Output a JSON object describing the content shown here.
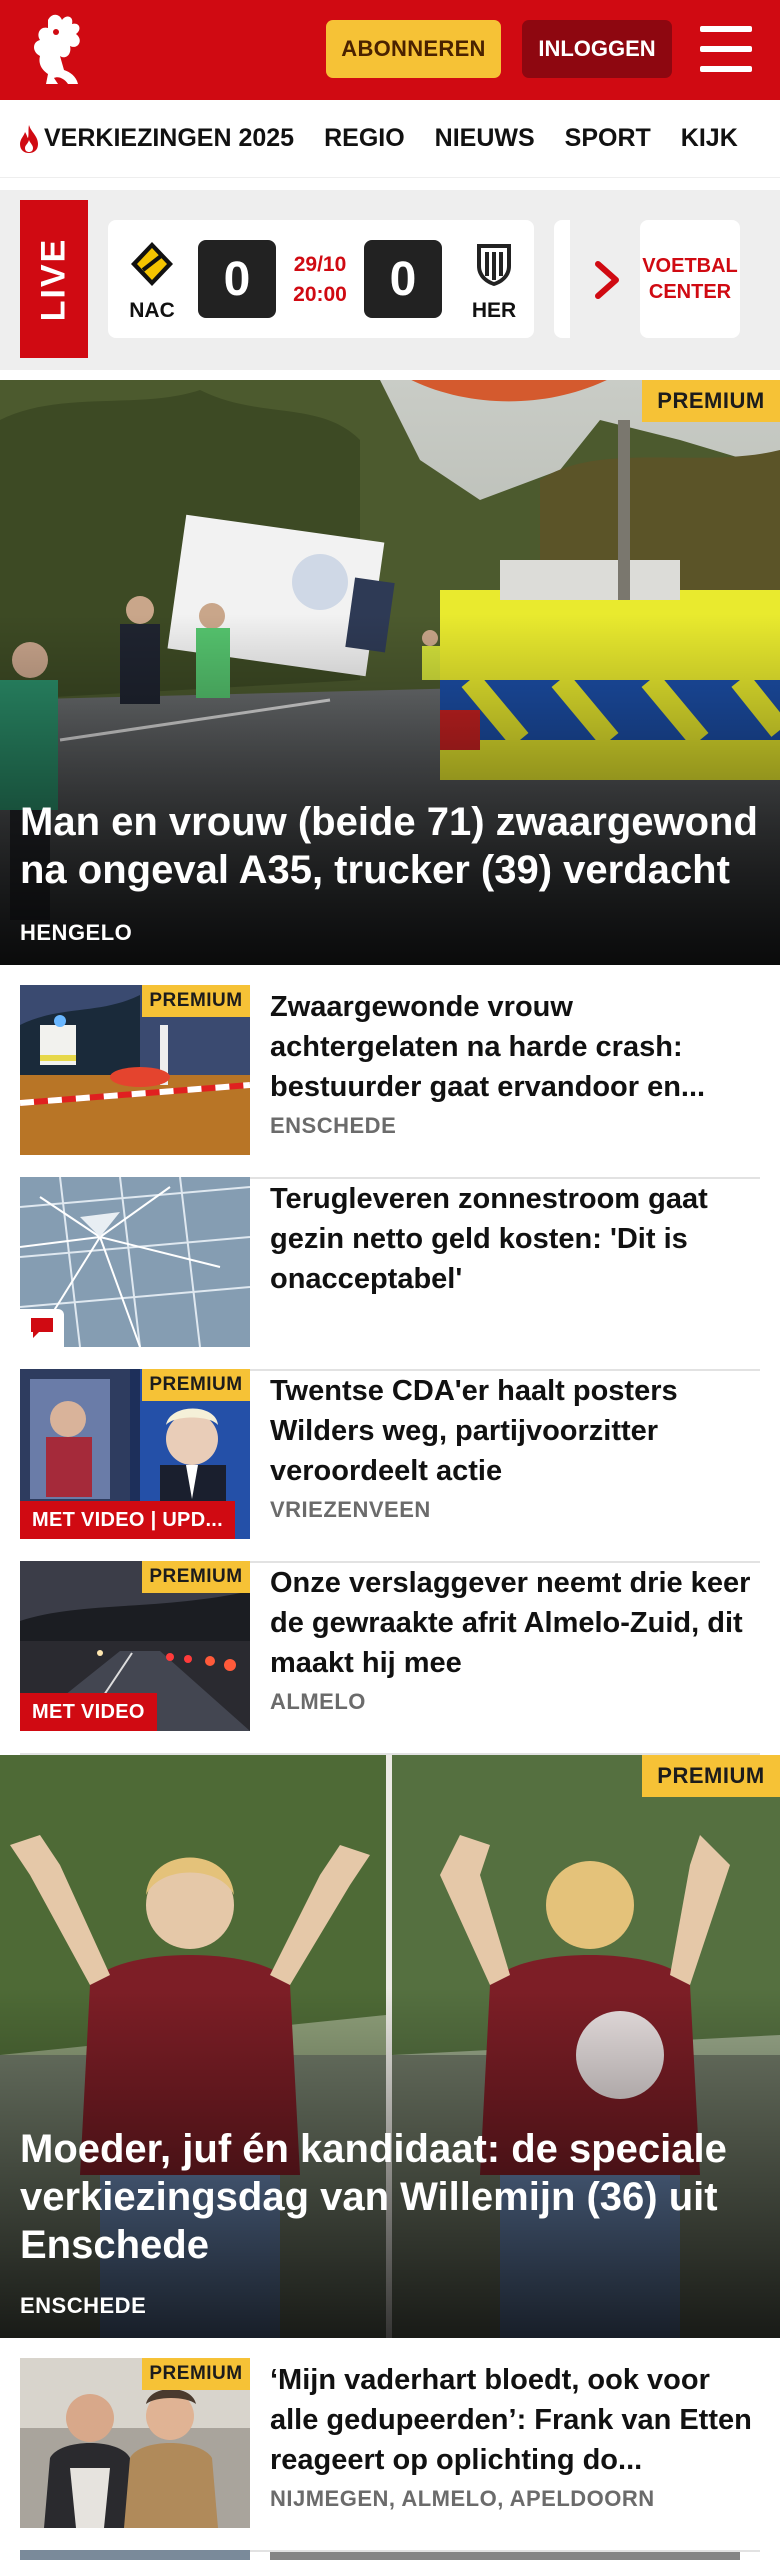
{
  "header": {
    "subscribe_label": "ABONNEREN",
    "login_label": "INLOGGEN",
    "brand_color": "#d00a12"
  },
  "nav": {
    "items": [
      "VERKIEZINGEN 2025",
      "REGIO",
      "NIEUWS",
      "SPORT",
      "KIJK"
    ]
  },
  "live": {
    "label": "LIVE",
    "match": {
      "home": "NAC",
      "away": "HER",
      "home_score": "0",
      "away_score": "0",
      "date": "29/10",
      "time": "20:00"
    },
    "voetbal_center": "VOETBAL CENTER"
  },
  "hero1": {
    "premium": "PREMIUM",
    "title": "Man en vrouw (beide 71) zwaargewond na ongeval A35, trucker (39) verdacht",
    "location": "HENGELO"
  },
  "articles": [
    {
      "title": "Zwaargewonde vrouw achtergelaten na harde crash: bestuurder gaat ervandoor en...",
      "location": "ENSCHEDE",
      "premium": "PREMIUM"
    },
    {
      "title": "Terugleveren zonnestroom gaat gezin netto geld kosten: 'Dit is onacceptabel'",
      "icon": "comment-icon"
    },
    {
      "title": "Twentse CDA'er haalt posters Wilders weg, partijvoorzitter veroordeelt actie",
      "location": "VRIEZENVEEN",
      "premium": "PREMIUM",
      "badge": "MET VIDEO | UPD..."
    },
    {
      "title": "Onze verslaggever neemt drie keer de gewraakte afrit Almelo-Zuid, dit maakt hij mee",
      "location": "ALMELO",
      "premium": "PREMIUM",
      "badge": "MET VIDEO"
    }
  ],
  "hero2": {
    "premium": "PREMIUM",
    "title": "Moeder, juf én kandidaat: de speciale verkiezingsdag van Willemijn (36) uit Enschede",
    "location": "ENSCHEDE"
  },
  "articles2": [
    {
      "title": "‘Mijn vaderhart bloedt, ook voor alle gedupeerden’: Frank van Etten reageert op oplichting do...",
      "location": "NIJMEGEN, ALMELO, APELDOORN",
      "premium": "PREMIUM"
    }
  ]
}
